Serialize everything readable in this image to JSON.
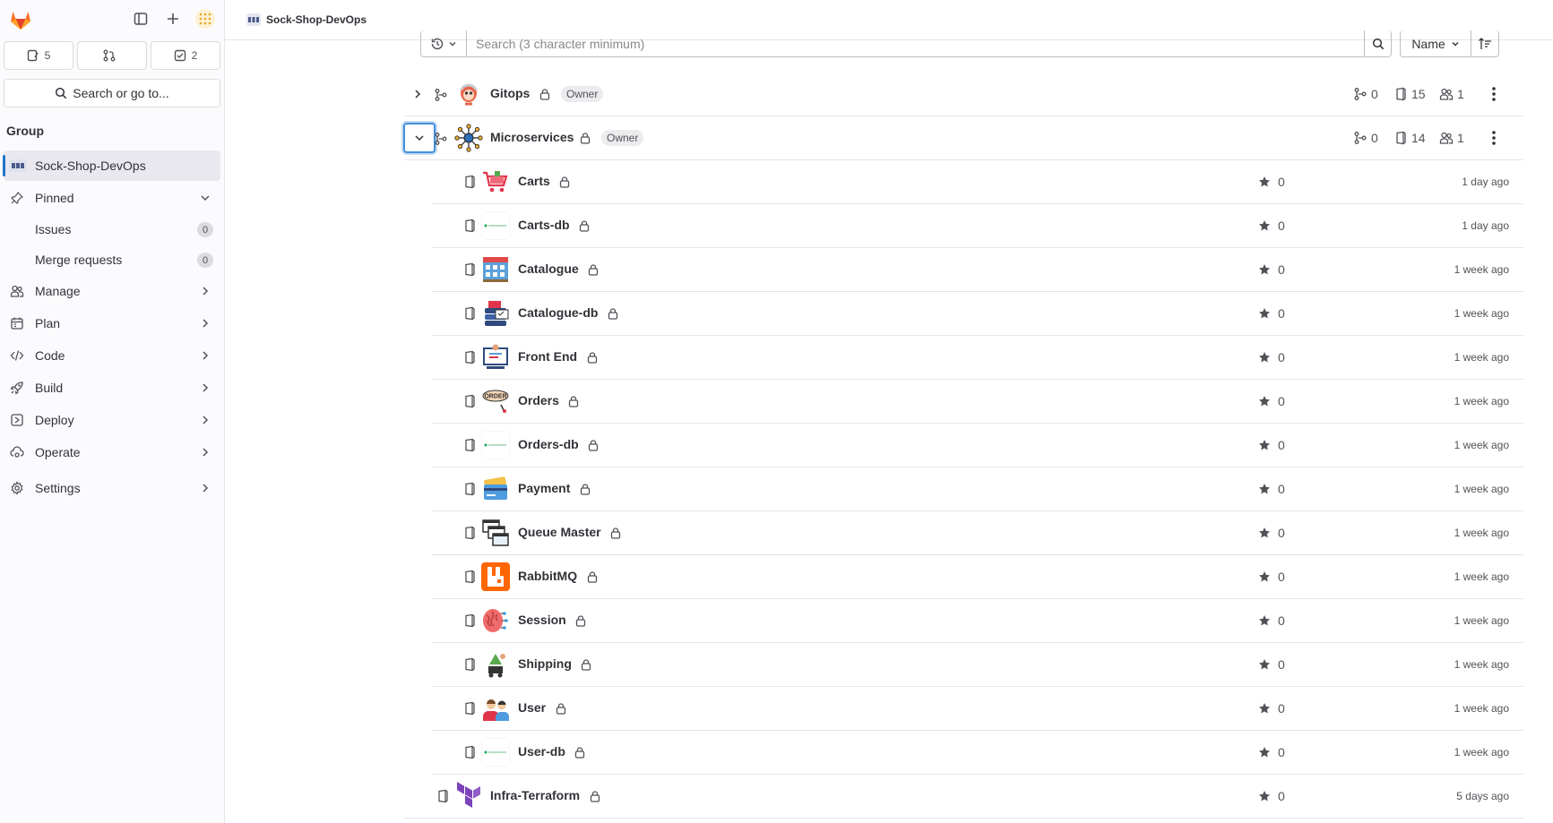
{
  "sidebar": {
    "counters": [
      {
        "icon": "issues-icon",
        "count": "5"
      },
      {
        "icon": "merge-request-icon",
        "count": ""
      },
      {
        "icon": "todo-icon",
        "count": "2"
      }
    ],
    "search_label": "Search or go to...",
    "group_heading": "Group",
    "context_item": "Sock-Shop-DevOps",
    "pinned_label": "Pinned",
    "pinned_items": [
      {
        "label": "Issues",
        "count": "0"
      },
      {
        "label": "Merge requests",
        "count": "0"
      }
    ],
    "nav_items": [
      {
        "label": "Manage",
        "icon": "members-icon"
      },
      {
        "label": "Plan",
        "icon": "calendar-icon"
      },
      {
        "label": "Code",
        "icon": "code-icon"
      },
      {
        "label": "Build",
        "icon": "rocket-icon"
      },
      {
        "label": "Deploy",
        "icon": "deployments-icon"
      },
      {
        "label": "Operate",
        "icon": "cloud-gear-icon"
      },
      {
        "label": "Settings",
        "icon": "settings-icon"
      }
    ]
  },
  "topbar": {
    "breadcrumb": "Sock-Shop-DevOps"
  },
  "filter": {
    "search_placeholder": "Search (3 character minimum)",
    "sort_label": "Name"
  },
  "groups": [
    {
      "name": "Gitops",
      "role": "Owner",
      "subgroups": "0",
      "projects": "15",
      "members": "1",
      "expanded": false
    },
    {
      "name": "Microservices",
      "role": "Owner",
      "subgroups": "0",
      "projects": "14",
      "members": "1",
      "expanded": true
    }
  ],
  "projects": [
    {
      "name": "Carts",
      "stars": "0",
      "updated": "1 day ago",
      "avatar": "cart"
    },
    {
      "name": "Carts-db",
      "stars": "0",
      "updated": "1 day ago",
      "avatar": "db"
    },
    {
      "name": "Catalogue",
      "stars": "0",
      "updated": "1 week ago",
      "avatar": "store"
    },
    {
      "name": "Catalogue-db",
      "stars": "0",
      "updated": "1 week ago",
      "avatar": "catalogdb"
    },
    {
      "name": "Front End",
      "stars": "0",
      "updated": "1 week ago",
      "avatar": "frontend"
    },
    {
      "name": "Orders",
      "stars": "0",
      "updated": "1 week ago",
      "avatar": "order"
    },
    {
      "name": "Orders-db",
      "stars": "0",
      "updated": "1 week ago",
      "avatar": "db"
    },
    {
      "name": "Payment",
      "stars": "0",
      "updated": "1 week ago",
      "avatar": "card"
    },
    {
      "name": "Queue Master",
      "stars": "0",
      "updated": "1 week ago",
      "avatar": "queue"
    },
    {
      "name": "RabbitMQ",
      "stars": "0",
      "updated": "1 week ago",
      "avatar": "rabbit"
    },
    {
      "name": "Session",
      "stars": "0",
      "updated": "1 week ago",
      "avatar": "brain"
    },
    {
      "name": "Shipping",
      "stars": "0",
      "updated": "1 week ago",
      "avatar": "ship"
    },
    {
      "name": "User",
      "stars": "0",
      "updated": "1 week ago",
      "avatar": "user"
    },
    {
      "name": "User-db",
      "stars": "0",
      "updated": "1 week ago",
      "avatar": "db"
    }
  ],
  "top_project": {
    "name": "Infra-Terraform",
    "stars": "0",
    "updated": "5 days ago",
    "avatar": "terraform"
  },
  "avatar_texts": {
    "order": "ORDER"
  },
  "colors": {
    "accent": "#1f75cb",
    "focus": "#428fdc",
    "rabbit": "#ff6600",
    "terraform": "#7b42bc"
  }
}
